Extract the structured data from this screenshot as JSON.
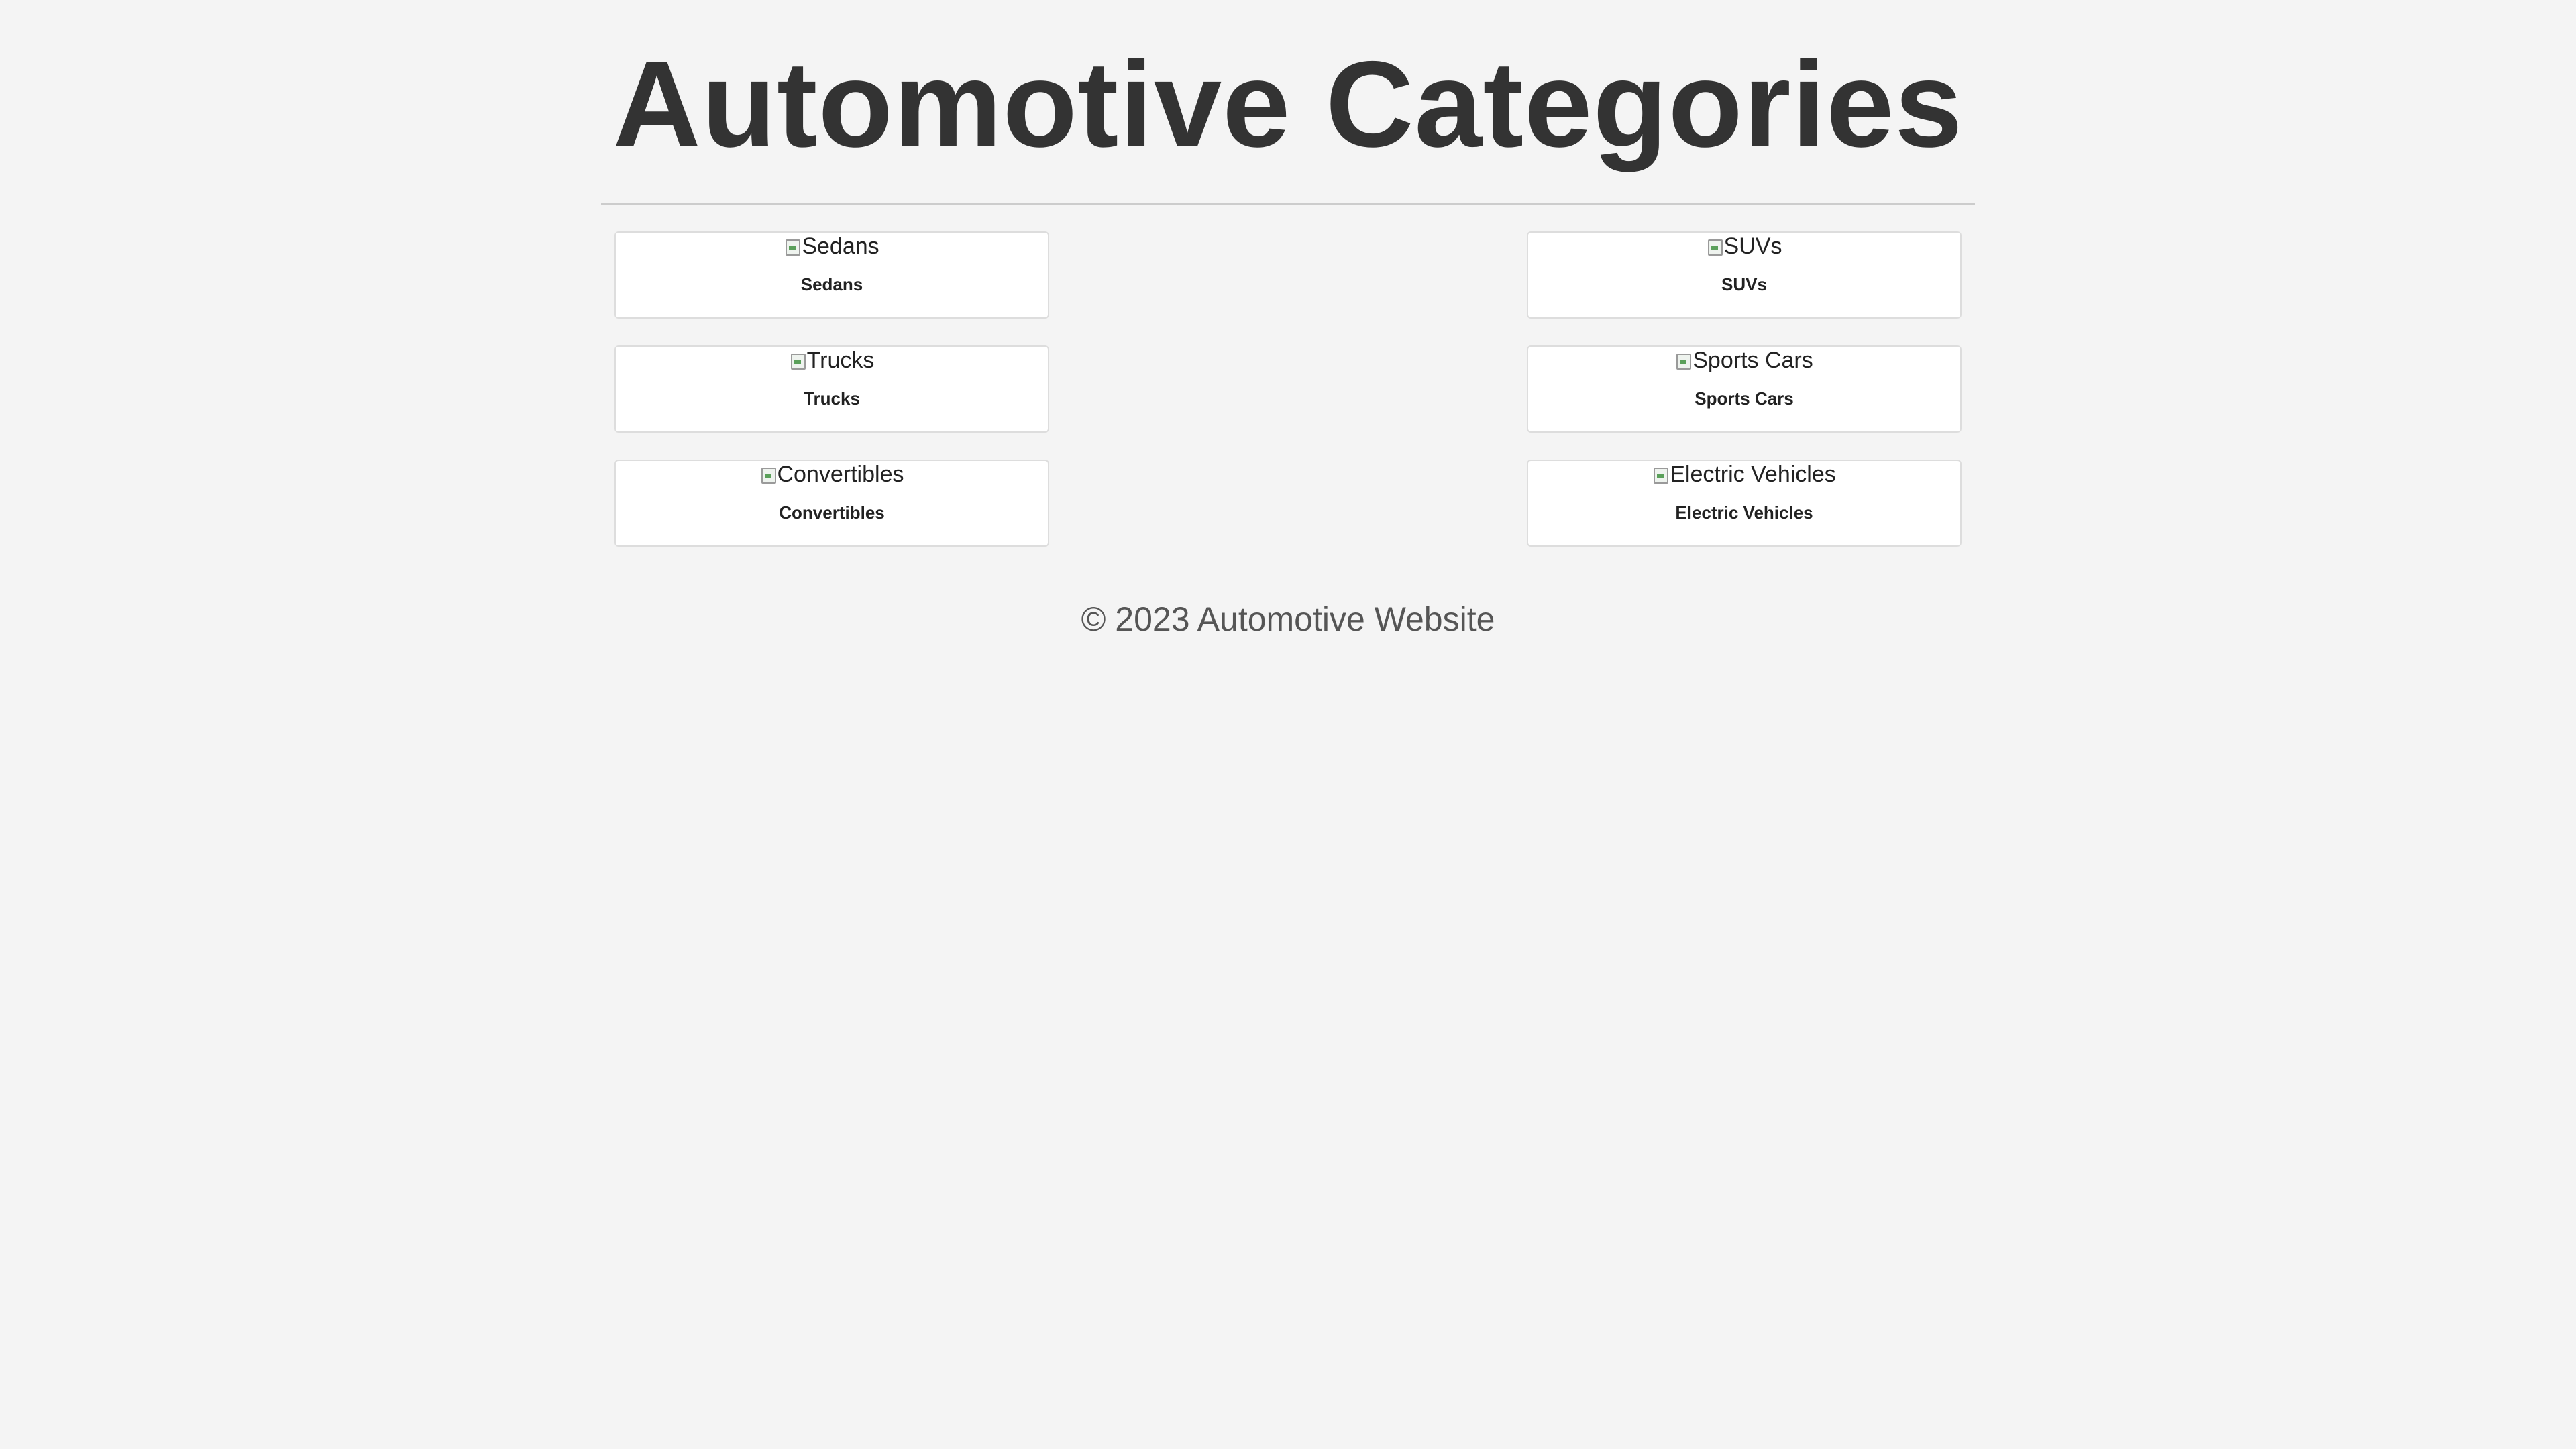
{
  "header": {
    "title": "Automotive Categories"
  },
  "categories": [
    {
      "label": "Sedans",
      "image_alt": "Sedans"
    },
    {
      "label": "SUVs",
      "image_alt": "SUVs"
    },
    {
      "label": "Trucks",
      "image_alt": "Trucks"
    },
    {
      "label": "Sports Cars",
      "image_alt": "Sports Cars"
    },
    {
      "label": "Convertibles",
      "image_alt": "Convertibles"
    },
    {
      "label": "Electric Vehicles",
      "image_alt": "Electric Vehicles"
    }
  ],
  "footer": {
    "text": "© 2023 Automotive Website"
  },
  "colors": {
    "background": "#f4f4f4",
    "heading": "#333333",
    "card_background": "#ffffff",
    "card_border": "#dddddd",
    "footer_text": "#555555"
  }
}
